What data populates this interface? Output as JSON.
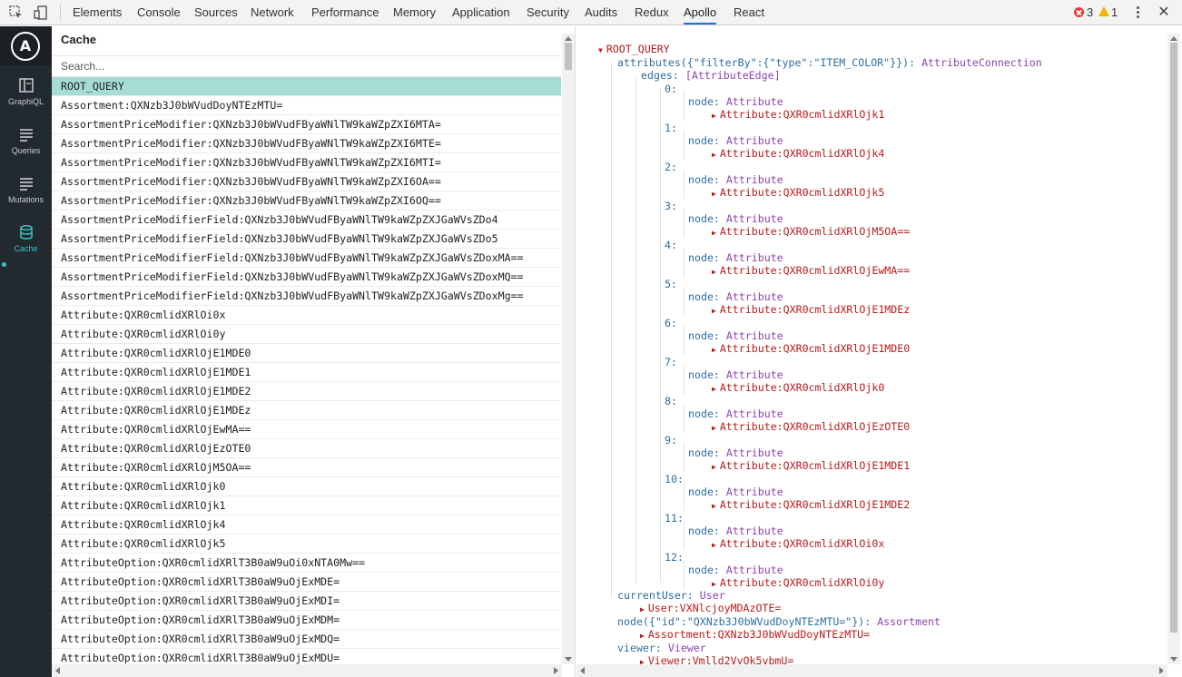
{
  "devtools": {
    "tabs": [
      "Elements",
      "Console",
      "Sources",
      "Network",
      "Performance",
      "Memory",
      "Application",
      "Security",
      "Audits",
      "Redux",
      "Apollo",
      "React"
    ],
    "active_tab": "Apollo",
    "error_count": "3",
    "warning_count": "1"
  },
  "nav": {
    "items": [
      {
        "label": "GraphiQL",
        "icon": "graphiql-icon"
      },
      {
        "label": "Queries",
        "icon": "queries-icon"
      },
      {
        "label": "Mutations",
        "icon": "mutations-icon"
      },
      {
        "label": "Cache",
        "icon": "database-icon"
      }
    ],
    "active": "Cache"
  },
  "cache": {
    "title": "Cache",
    "search_placeholder": "Search...",
    "selected": "ROOT_QUERY",
    "entries": [
      "ROOT_QUERY",
      "Assortment:QXNzb3J0bWVudDoyNTEzMTU=",
      "AssortmentPriceModifier:QXNzb3J0bWVudFByaWNlTW9kaWZpZXI6MTA=",
      "AssortmentPriceModifier:QXNzb3J0bWVudFByaWNlTW9kaWZpZXI6MTE=",
      "AssortmentPriceModifier:QXNzb3J0bWVudFByaWNlTW9kaWZpZXI6MTI=",
      "AssortmentPriceModifier:QXNzb3J0bWVudFByaWNlTW9kaWZpZXI6OA==",
      "AssortmentPriceModifier:QXNzb3J0bWVudFByaWNlTW9kaWZpZXI6OQ==",
      "AssortmentPriceModifierField:QXNzb3J0bWVudFByaWNlTW9kaWZpZXJGaWVsZDo4",
      "AssortmentPriceModifierField:QXNzb3J0bWVudFByaWNlTW9kaWZpZXJGaWVsZDo5",
      "AssortmentPriceModifierField:QXNzb3J0bWVudFByaWNlTW9kaWZpZXJGaWVsZDoxMA==",
      "AssortmentPriceModifierField:QXNzb3J0bWVudFByaWNlTW9kaWZpZXJGaWVsZDoxMQ==",
      "AssortmentPriceModifierField:QXNzb3J0bWVudFByaWNlTW9kaWZpZXJGaWVsZDoxMg==",
      "Attribute:QXR0cmlidXRlOi0x",
      "Attribute:QXR0cmlidXRlOi0y",
      "Attribute:QXR0cmlidXRlOjE1MDE0",
      "Attribute:QXR0cmlidXRlOjE1MDE1",
      "Attribute:QXR0cmlidXRlOjE1MDE2",
      "Attribute:QXR0cmlidXRlOjE1MDEz",
      "Attribute:QXR0cmlidXRlOjEwMA==",
      "Attribute:QXR0cmlidXRlOjEzOTE0",
      "Attribute:QXR0cmlidXRlOjM5OA==",
      "Attribute:QXR0cmlidXRlOjk0",
      "Attribute:QXR0cmlidXRlOjk1",
      "Attribute:QXR0cmlidXRlOjk4",
      "Attribute:QXR0cmlidXRlOjk5",
      "AttributeOption:QXR0cmlidXRlT3B0aW9uOi0xNTA0Mw==",
      "AttributeOption:QXR0cmlidXRlT3B0aW9uOjExMDE=",
      "AttributeOption:QXR0cmlidXRlT3B0aW9uOjExMDI=",
      "AttributeOption:QXR0cmlidXRlT3B0aW9uOjExMDM=",
      "AttributeOption:QXR0cmlidXRlT3B0aW9uOjExMDQ=",
      "AttributeOption:QXR0cmlidXRlT3B0aW9uOjExMDU="
    ]
  },
  "detail": {
    "root": "ROOT_QUERY",
    "attributes_key": "attributes({\"filterBy\":{\"type\":\"ITEM_COLOR\"}})",
    "attributes_type": "AttributeConnection",
    "edges_key": "edges",
    "edges_type": "[AttributeEdge]",
    "node_key": "node",
    "node_type": "Attribute",
    "edges": [
      {
        "index": "0:",
        "ref": "Attribute:QXR0cmlidXRlOjk1"
      },
      {
        "index": "1:",
        "ref": "Attribute:QXR0cmlidXRlOjk4"
      },
      {
        "index": "2:",
        "ref": "Attribute:QXR0cmlidXRlOjk5"
      },
      {
        "index": "3:",
        "ref": "Attribute:QXR0cmlidXRlOjM5OA=="
      },
      {
        "index": "4:",
        "ref": "Attribute:QXR0cmlidXRlOjEwMA=="
      },
      {
        "index": "5:",
        "ref": "Attribute:QXR0cmlidXRlOjE1MDEz"
      },
      {
        "index": "6:",
        "ref": "Attribute:QXR0cmlidXRlOjE1MDE0"
      },
      {
        "index": "7:",
        "ref": "Attribute:QXR0cmlidXRlOjk0"
      },
      {
        "index": "8:",
        "ref": "Attribute:QXR0cmlidXRlOjEzOTE0"
      },
      {
        "index": "9:",
        "ref": "Attribute:QXR0cmlidXRlOjE1MDE1"
      },
      {
        "index": "10:",
        "ref": "Attribute:QXR0cmlidXRlOjE1MDE2"
      },
      {
        "index": "11:",
        "ref": "Attribute:QXR0cmlidXRlOi0x"
      },
      {
        "index": "12:",
        "ref": "Attribute:QXR0cmlidXRlOi0y"
      }
    ],
    "tail": [
      {
        "key": "currentUser",
        "type": "User",
        "ref": "User:VXNlcjoyMDAzOTE="
      },
      {
        "key": "node({\"id\":\"QXNzb3J0bWVudDoyNTEzMTU=\"})",
        "type": "Assortment",
        "ref": "Assortment:QXNzb3J0bWVudDoyNTEzMTU="
      },
      {
        "key": "viewer",
        "type": "Viewer",
        "ref": "Viewer:Vmlld2VyOk5vbmU="
      }
    ]
  }
}
